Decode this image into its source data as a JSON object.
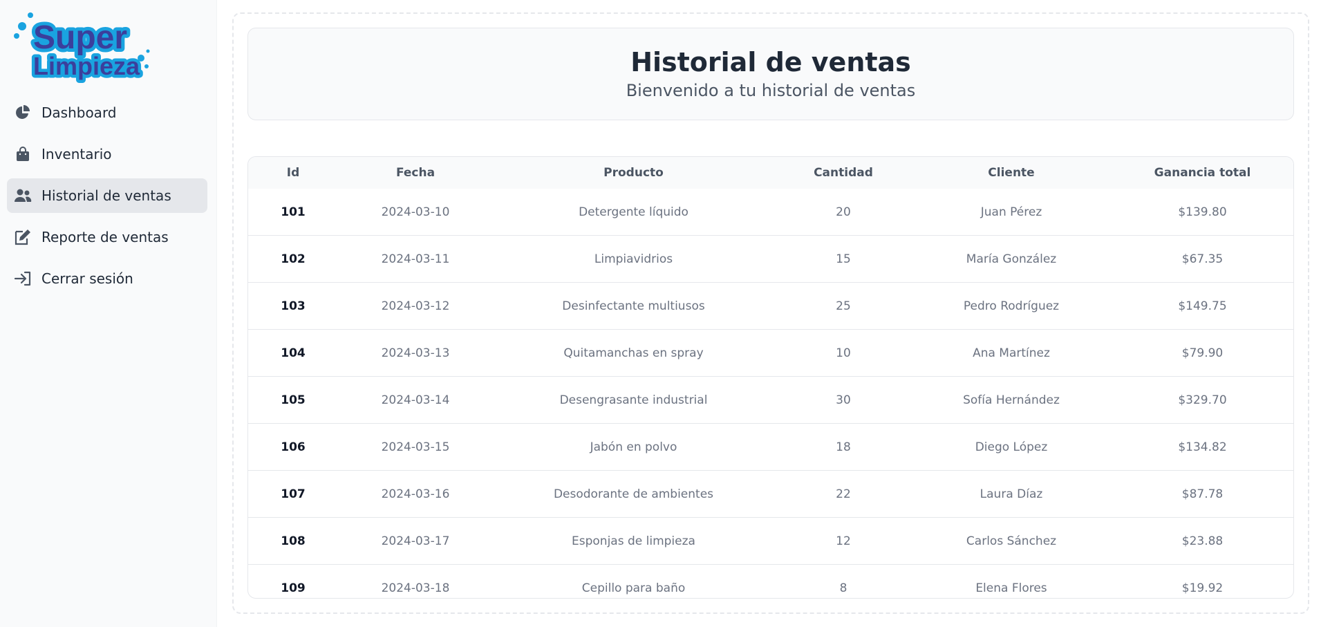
{
  "brand": {
    "line1": "Super",
    "line2": "Limpieza",
    "primary_color": "#3b3f9c",
    "accent_color": "#1aa3e0"
  },
  "sidebar": {
    "items": [
      {
        "label": "Dashboard",
        "icon": "pie-chart-icon",
        "active": false
      },
      {
        "label": "Inventario",
        "icon": "shopping-bag-icon",
        "active": false
      },
      {
        "label": "Historial de ventas",
        "icon": "users-icon",
        "active": true
      },
      {
        "label": "Reporte de ventas",
        "icon": "edit-document-icon",
        "active": false
      },
      {
        "label": "Cerrar sesión",
        "icon": "sign-in-icon",
        "active": false
      }
    ]
  },
  "header": {
    "title": "Historial de ventas",
    "subtitle": "Bienvenido a tu historial de ventas"
  },
  "table": {
    "columns": [
      "Id",
      "Fecha",
      "Producto",
      "Cantidad",
      "Cliente",
      "Ganancia total"
    ],
    "rows": [
      [
        "101",
        "2024-03-10",
        "Detergente líquido",
        "20",
        "Juan Pérez",
        "$139.80"
      ],
      [
        "102",
        "2024-03-11",
        "Limpiavidrios",
        "15",
        "María González",
        "$67.35"
      ],
      [
        "103",
        "2024-03-12",
        "Desinfectante multiusos",
        "25",
        "Pedro Rodríguez",
        "$149.75"
      ],
      [
        "104",
        "2024-03-13",
        "Quitamanchas en spray",
        "10",
        "Ana Martínez",
        "$79.90"
      ],
      [
        "105",
        "2024-03-14",
        "Desengrasante industrial",
        "30",
        "Sofía Hernández",
        "$329.70"
      ],
      [
        "106",
        "2024-03-15",
        "Jabón en polvo",
        "18",
        "Diego López",
        "$134.82"
      ],
      [
        "107",
        "2024-03-16",
        "Desodorante de ambientes",
        "22",
        "Laura Díaz",
        "$87.78"
      ],
      [
        "108",
        "2024-03-17",
        "Esponjas de limpieza",
        "12",
        "Carlos Sánchez",
        "$23.88"
      ],
      [
        "109",
        "2024-03-18",
        "Cepillo para baño",
        "8",
        "Elena Flores",
        "$19.92"
      ]
    ]
  }
}
